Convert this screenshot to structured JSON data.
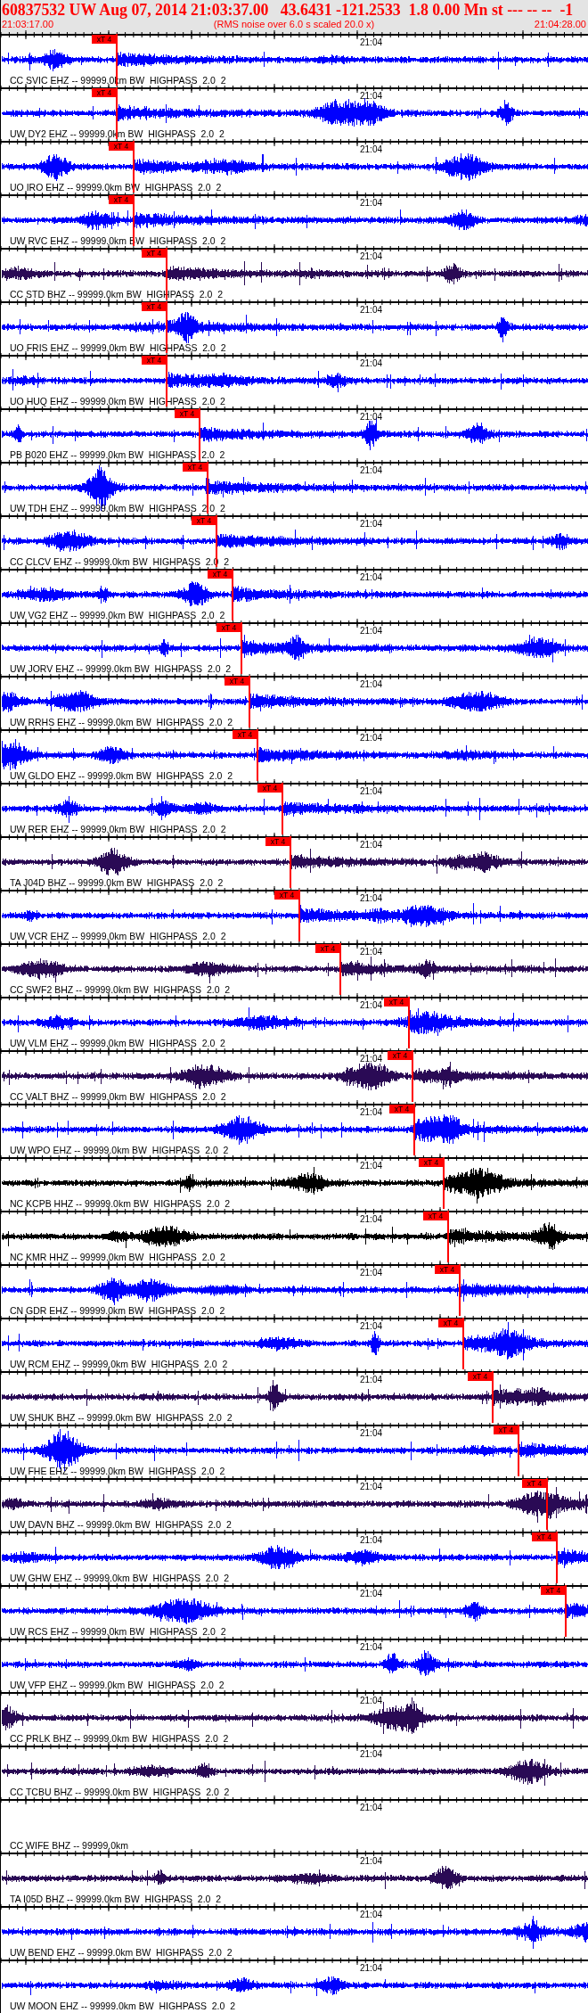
{
  "header": {
    "title": "60837532 UW Aug 07, 2014 21:03:37.00   43.6431 -121.2533  1.8 0.00 Mn st --- -- --  -1",
    "start_time": "21:03:17.00",
    "caption": "(RMS noise over 6.0 s scaled 20.0 x)",
    "end_time": "21:04:28.00"
  },
  "stations": [
    {
      "label": "CC SVIC EHZ -- 99999.0km BW  HIGHPASS  2.0  2",
      "color": "#0000ff",
      "tick_label": "21:04",
      "pick": {
        "label": "xT 4"
      }
    },
    {
      "label": "UW DY2 EHZ -- 99999.0km BW  HIGHPASS  2.0  2",
      "color": "#0000ff",
      "tick_label": "21:04",
      "pick": {
        "label": "xT 4"
      }
    },
    {
      "label": "UO IRO EHZ -- 99999.0km BW  HIGHPASS  2.0  2",
      "color": "#0000ff",
      "tick_label": "21:04",
      "pick": {
        "label": "xT 4"
      }
    },
    {
      "label": "UW RVC EHZ -- 99999.0km BW  HIGHPASS  2.0  2",
      "color": "#0000ff",
      "tick_label": "21:04",
      "pick": {
        "label": "xT 4"
      }
    },
    {
      "label": "CC STD BHZ -- 99999.0km BW  HIGHPASS  2.0  2",
      "color": "#2a0a55",
      "tick_label": "21:04",
      "pick": {
        "label": "xT 4"
      }
    },
    {
      "label": "UO FRIS EHZ -- 99999.0km BW  HIGHPASS  2.0  2",
      "color": "#0000ff",
      "tick_label": "21:04",
      "pick": {
        "label": "xT 4"
      }
    },
    {
      "label": "UO HUQ EHZ -- 99999.0km BW  HIGHPASS  2.0  2",
      "color": "#0000ff",
      "tick_label": "21:04",
      "pick": {
        "label": "xT 4"
      }
    },
    {
      "label": "PB B020 EHZ -- 99999.0km BW  HIGHPASS  2.0  2",
      "color": "#0000ff",
      "tick_label": "21:04",
      "pick": {
        "label": "xT 4"
      }
    },
    {
      "label": "UW TDH EHZ -- 99999.0km BW  HIGHPASS  2.0  2",
      "color": "#0000ff",
      "tick_label": "21:04",
      "pick": {
        "label": "xT 4"
      }
    },
    {
      "label": "CC CLCV EHZ -- 99999.0km BW  HIGHPASS  2.0  2",
      "color": "#0000ff",
      "tick_label": "21:04",
      "pick": {
        "label": "xT 4"
      }
    },
    {
      "label": "UW VG2 EHZ -- 99999.0km BW  HIGHPASS  2.0  2",
      "color": "#0000ff",
      "tick_label": "21:04",
      "pick": {
        "label": "xT 4"
      }
    },
    {
      "label": "UW JORV EHZ -- 99999.0km BW  HIGHPASS  2.0  2",
      "color": "#0000ff",
      "tick_label": "21:04",
      "pick": {
        "label": "xT 4"
      }
    },
    {
      "label": "UW RRHS EHZ -- 99999.0km BW  HIGHPASS  2.0  2",
      "color": "#0000ff",
      "tick_label": "21:04",
      "pick": {
        "label": "xT 4"
      }
    },
    {
      "label": "UW GLDO EHZ -- 99999.0km BW  HIGHPASS  2.0  2",
      "color": "#0000ff",
      "tick_label": "21:04",
      "pick": {
        "label": "xT 4"
      }
    },
    {
      "label": "UW RER EHZ -- 99999.0km BW  HIGHPASS  2.0  2",
      "color": "#0000ff",
      "tick_label": "21:04",
      "pick": {
        "label": "xT 4"
      }
    },
    {
      "label": "TA J04D BHZ -- 99999.0km BW  HIGHPASS  2.0  2",
      "color": "#2a0a55",
      "tick_label": "21:04",
      "pick": {
        "label": "xT 4"
      }
    },
    {
      "label": "UW VCR EHZ -- 99999.0km BW  HIGHPASS  2.0  2",
      "color": "#0000ff",
      "tick_label": "21:04",
      "pick": {
        "label": "xT 4"
      }
    },
    {
      "label": "CC SWF2 BHZ -- 99999.0km BW  HIGHPASS  2.0  2",
      "color": "#2a0a55",
      "tick_label": "21:04",
      "pick": {
        "label": "xT 4"
      }
    },
    {
      "label": "UW VLM EHZ -- 99999.0km BW  HIGHPASS  2.0  2",
      "color": "#0000ff",
      "tick_label": "21:04",
      "pick": {
        "label": "xT 4"
      }
    },
    {
      "label": "CC VALT BHZ -- 99999.0km BW  HIGHPASS  2.0  2",
      "color": "#2a0a55",
      "tick_label": "21:04",
      "pick": {
        "label": "xT 4"
      }
    },
    {
      "label": "UW WPO EHZ -- 99999.0km BW  HIGHPASS  2.0  2",
      "color": "#0000ff",
      "tick_label": "21:04",
      "pick": {
        "label": "xT 4"
      }
    },
    {
      "label": "NC KCPB HHZ -- 99999.0km BW  HIGHPASS  2.0  2",
      "color": "#000000",
      "tick_label": "21:04",
      "pick": {
        "label": "xT 4"
      }
    },
    {
      "label": "NC KMR HHZ -- 99999.0km BW  HIGHPASS  2.0  2",
      "color": "#000000",
      "tick_label": "21:04",
      "pick": {
        "label": "xT 4"
      }
    },
    {
      "label": "CN GDR EHZ -- 99999.0km BW  HIGHPASS  2.0  2",
      "color": "#0000ff",
      "tick_label": "21:04",
      "pick": {
        "label": "xT 4"
      }
    },
    {
      "label": "UW RCM EHZ -- 99999.0km BW  HIGHPASS  2.0  2",
      "color": "#0000ff",
      "tick_label": "21:04",
      "pick": {
        "label": "xT 4"
      }
    },
    {
      "label": "UW SHUK BHZ -- 99999.0km BW  HIGHPASS  2.0  2",
      "color": "#2a0a55",
      "tick_label": "21:04",
      "pick": {
        "label": "xT 4"
      }
    },
    {
      "label": "UW FHE EHZ -- 99999.0km BW  HIGHPASS  2.0  2",
      "color": "#0000ff",
      "tick_label": "21:04",
      "pick": {
        "label": "xT 4"
      }
    },
    {
      "label": "UW DAVN BHZ -- 99999.0km BW  HIGHPASS  2.0  2",
      "color": "#2a0a55",
      "tick_label": "21:04",
      "pick": {
        "label": "xT 4"
      }
    },
    {
      "label": "UW GHW EHZ -- 99999.0km BW  HIGHPASS  2.0  2",
      "color": "#0000ff",
      "tick_label": "21:04",
      "pick": {
        "label": "xT 4"
      }
    },
    {
      "label": "UW RCS EHZ -- 99999.0km BW  HIGHPASS  2.0  2",
      "color": "#0000ff",
      "tick_label": "21:04",
      "pick": {
        "label": "xT 4"
      }
    },
    {
      "label": "UW VFP EHZ -- 99999.0km BW  HIGHPASS  2.0  2",
      "color": "#0000ff",
      "tick_label": "21:04"
    },
    {
      "label": "CC PRLK BHZ -- 99999.0km BW  HIGHPASS  2.0  2",
      "color": "#2a0a55",
      "tick_label": "21:04"
    },
    {
      "label": "CC TCBU BHZ -- 99999.0km BW  HIGHPASS  2.0  2",
      "color": "#2a0a55",
      "tick_label": "21:04"
    },
    {
      "label": "CC WIFE BHZ -- 99999.0km",
      "tick_label": "21:04"
    },
    {
      "label": "TA I05D BHZ -- 99999.0km BW  HIGHPASS  2.0  2",
      "color": "#2a0a55",
      "tick_label": "21:04"
    },
    {
      "label": "UW BEND EHZ -- 99999.0km BW  HIGHPASS  2.0  2",
      "color": "#0000ff",
      "tick_label": "21:04"
    },
    {
      "label": "UW MOON EHZ -- 99999.0km BW  HIGHPASS  2.0  2",
      "color": "#0000ff",
      "tick_label": "21:04"
    }
  ]
}
